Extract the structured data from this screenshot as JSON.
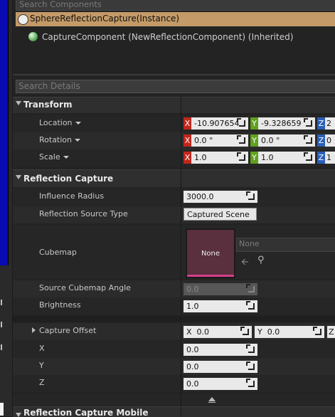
{
  "component_search": {
    "placeholder": "Search Components"
  },
  "actor": {
    "name": "SphereReflectionCapture(Instance)"
  },
  "component": {
    "name": "CaptureComponent (NewReflectionComponent) (Inherited)"
  },
  "details_search": {
    "placeholder": "Search Details"
  },
  "transform": {
    "title": "Transform",
    "location": {
      "label": "Location",
      "x": "-10.907654",
      "y": "-9.328659",
      "z": "2"
    },
    "rotation": {
      "label": "Rotation",
      "x": "0.0 °",
      "y": "0.0 °",
      "z": "0"
    },
    "scale": {
      "label": "Scale",
      "x": "1.0",
      "y": "1.0",
      "z": "1"
    }
  },
  "reflection_capture": {
    "title": "Reflection Capture",
    "influence_radius": {
      "label": "Influence Radius",
      "value": "3000.0"
    },
    "source_type": {
      "label": "Reflection Source Type",
      "value": "Captured Scene"
    },
    "cubemap": {
      "label": "Cubemap",
      "thumb": "None",
      "asset": "None"
    },
    "source_angle": {
      "label": "Source Cubemap Angle",
      "value": "0.0"
    },
    "brightness": {
      "label": "Brightness",
      "value": "1.0"
    },
    "capture_offset": {
      "label": "Capture Offset",
      "x": "0.0",
      "y": "0.0",
      "z": ""
    },
    "offset_x": {
      "label": "X",
      "value": "0.0"
    },
    "offset_y": {
      "label": "Y",
      "value": "0.0"
    },
    "offset_z": {
      "label": "Z",
      "value": "0.0"
    }
  },
  "mobile": {
    "title": "Reflection Capture Mobile"
  },
  "axes": {
    "x": "X",
    "y": "Y",
    "z": "Z"
  },
  "icons": {
    "use": "arrow-left-icon",
    "browse": "magnifier-icon"
  }
}
